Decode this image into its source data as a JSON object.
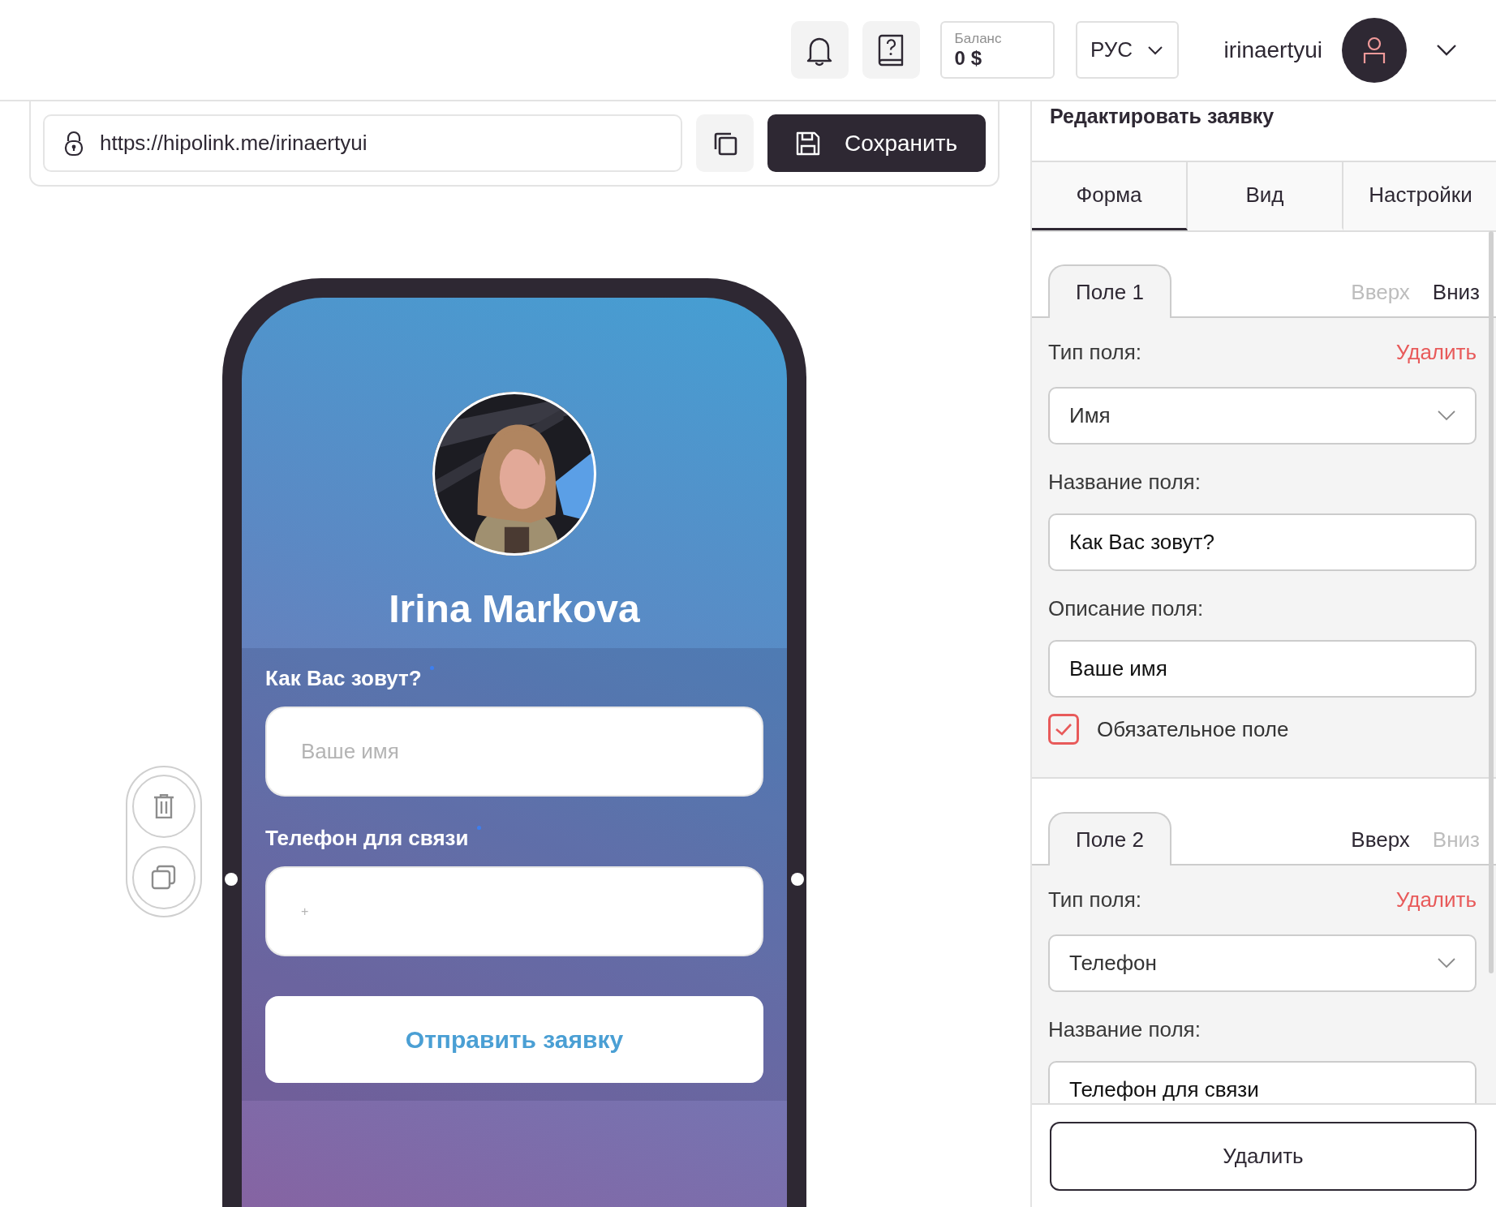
{
  "header": {
    "balance": {
      "label": "Баланс",
      "value": "0 $"
    },
    "language": "РУС",
    "username": "irinaertyui"
  },
  "toolbar": {
    "url": "https://hipolink.me/irinaertyui",
    "save_button": "Сохранить"
  },
  "preview": {
    "name": "Irina Markova",
    "fields": [
      {
        "label": "Как Вас зовут?",
        "required": true,
        "placeholder": "Ваше имя"
      },
      {
        "label": "Телефон для связи",
        "required": true,
        "placeholder": "+"
      }
    ],
    "submit_button": "Отправить заявку"
  },
  "editor": {
    "title": "Редактировать заявку",
    "tabs": [
      {
        "label": "Форма",
        "selected": true
      },
      {
        "label": "Вид",
        "selected": false
      },
      {
        "label": "Настройки",
        "selected": false
      }
    ],
    "fields": [
      {
        "tab": "Поле 1",
        "move_up": {
          "label": "Вверх",
          "disabled": true
        },
        "move_down": {
          "label": "Вниз",
          "disabled": false
        },
        "type_label": "Тип поля:",
        "delete_link": "Удалить",
        "type_value": "Имя",
        "name_label": "Название поля:",
        "name_value": "Как Вас зовут?",
        "description_label": "Описание поля:",
        "description_value": "Ваше имя",
        "required": {
          "label": "Обязательное поле",
          "checked": true
        }
      },
      {
        "tab": "Поле 2",
        "move_up": {
          "label": "Вверх",
          "disabled": false
        },
        "move_down": {
          "label": "Вниз",
          "disabled": true
        },
        "type_label": "Тип поля:",
        "delete_link": "Удалить",
        "type_value": "Телефон",
        "name_label": "Название поля:",
        "name_value": "Телефон для связи"
      }
    ],
    "delete_button": "Удалить"
  }
}
